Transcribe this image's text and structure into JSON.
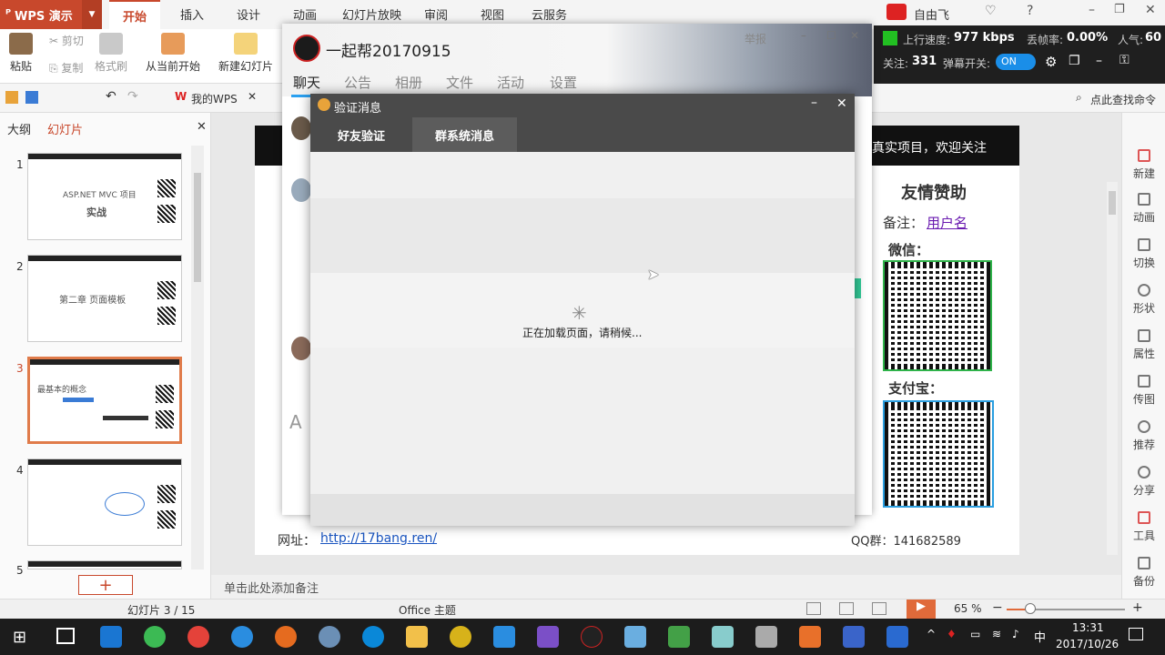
{
  "wps": {
    "app_title": "WPS 演示",
    "menu": [
      "开始",
      "插入",
      "设计",
      "动画",
      "幻灯片放映",
      "审阅",
      "视图",
      "云服务"
    ],
    "ribbon": {
      "paste": "粘贴",
      "cut": "剪切",
      "copy": "复制",
      "format_painter": "格式刷",
      "from_current": "从当前开始",
      "new_slide": "新建幻灯片"
    },
    "my_wps": "我的WPS",
    "find_command": "点此查找命令",
    "panel_tabs": [
      "大纲",
      "幻灯片"
    ],
    "slide_numbers": [
      "1",
      "2",
      "3",
      "4",
      "5"
    ],
    "thumb_texts": {
      "s1_line1": "ASP.NET MVC 项目",
      "s1_line2": "实战",
      "s2_line1": "第二章 页面模板",
      "s3_line1": "最基本的概念"
    },
    "notes_placeholder": "单击此处添加备注",
    "status": {
      "slide_count": "幻灯片 3 / 15",
      "theme": "Office 主题",
      "zoom": "65 %"
    },
    "right_sidebar": [
      "新建",
      "动画",
      "切换",
      "形状",
      "属性",
      "传图",
      "推荐",
      "分享",
      "工具",
      "备份"
    ],
    "user": "自由飞"
  },
  "slide": {
    "banner": "真实项目，欢迎关注",
    "sponsor_title": "友情赞助",
    "note_label": "备注：",
    "note_value": "用户名",
    "wechat": "微信：",
    "alipay": "支付宝：",
    "url_label": "网址：",
    "url": "http://17bang.ren/",
    "qq_group": "QQ群：141682589"
  },
  "stream": {
    "upload_label": "上行速度:",
    "upload_value": "977 kbps",
    "drop_label": "丢帧率:",
    "drop_value": "0.00%",
    "popularity_label": "人气:",
    "popularity_value": "60",
    "follow_label": "关注:",
    "follow_value": "331",
    "danmaku_label": "弹幕开关:",
    "danmaku_state": "ON"
  },
  "chat": {
    "title": "一起帮20170915",
    "report": "举报",
    "tabs": [
      "聊天",
      "公告",
      "相册",
      "文件",
      "活动",
      "设置"
    ]
  },
  "dialog": {
    "title": "验证消息",
    "tabs": [
      "好友验证",
      "群系统消息"
    ],
    "loading": "正在加载页面，请稍候..."
  },
  "taskbar": {
    "time": "13:31",
    "date": "2017/10/26",
    "ime": "中"
  },
  "colors": {
    "wps_accent": "#c8482c",
    "dialog_header": "#4a4a4a",
    "chat_accent": "#2aa0f0",
    "stream_green": "#22c022"
  }
}
